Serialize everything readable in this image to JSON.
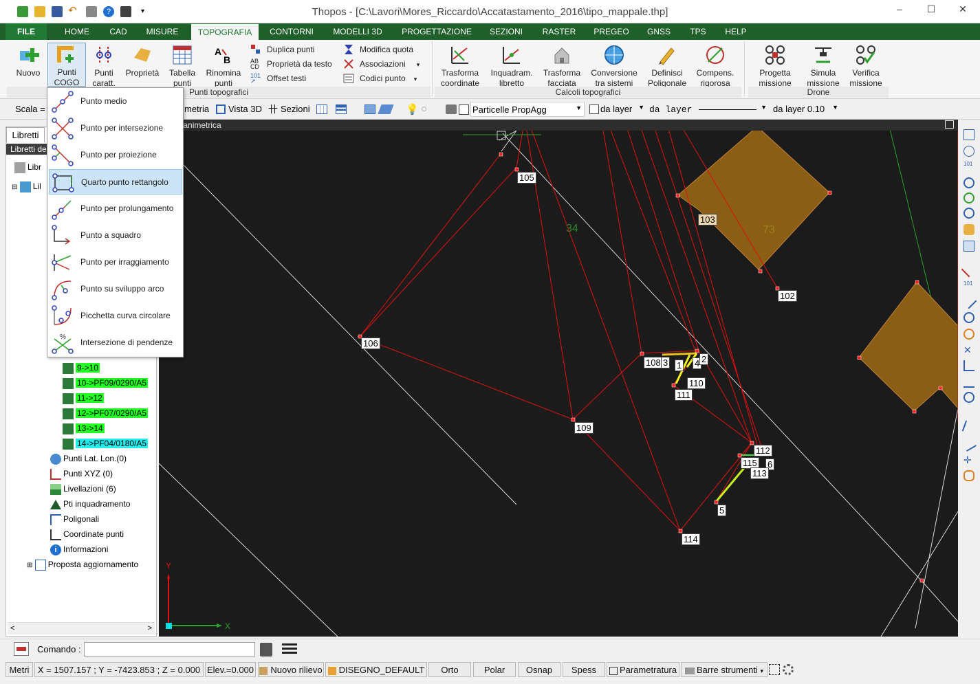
{
  "window": {
    "title": "Thopos - [C:\\Lavori\\Mores_Riccardo\\Accatastamento_2016\\tipo_mappale.thp]",
    "controls": [
      "–",
      "☐",
      "✕"
    ]
  },
  "ribbon_tabs": [
    "FILE",
    "HOME",
    "CAD",
    "MISURE",
    "TOPOGRAFIA",
    "CONTORNI",
    "MODELLI 3D",
    "PROGETTAZIONE",
    "SEZIONI",
    "RASTER",
    "PREGEO",
    "GNSS",
    "TPS",
    "HELP"
  ],
  "ribbon": {
    "nuovo": "Nuovo",
    "punti_cogo_1": "Punti",
    "punti_cogo_2": "COGO",
    "punti_caratt_1": "Punti",
    "punti_caratt_2": "caratt.",
    "proprieta": "Proprietà",
    "tabella_1": "Tabella",
    "tabella_2": "punti",
    "rinomina_1": "Rinomina",
    "rinomina_2": "punti",
    "duplica": "Duplica punti",
    "proprieta_testo": "Proprietà da testo",
    "offset": "Offset testi",
    "modifica_quota": "Modifica quota",
    "associazioni": "Associazioni",
    "codici": "Codici punto",
    "group_punti": "Punti topografici",
    "trasforma_1": "Trasforma",
    "trasforma_2": "coordinate",
    "inquadram_1": "Inquadram.",
    "inquadram_2": "libretto",
    "trasforma_f_1": "Trasforma",
    "trasforma_f_2": "facciata",
    "conversione_1": "Conversione",
    "conversione_2": "tra sistemi",
    "definisci_1": "Definisci",
    "definisci_2": "Poligonale",
    "compens_1": "Compens.",
    "compens_2": "rigorosa",
    "group_calcoli": "Calcoli topografici",
    "progetta_1": "Progetta",
    "progetta_2": "missione",
    "simula_1": "Simula",
    "simula_2": "missione",
    "verifica_1": "Verifica",
    "verifica_2": "missione",
    "group_drone": "Drone"
  },
  "toolbar2": {
    "scala": "Scala =",
    "planimetria": "metria",
    "vista3d": "Vista 3D",
    "sezioni": "Sezioni",
    "layer_combo": "Particelle PropAgg",
    "colore": "da layer",
    "linetype": "da layer",
    "spessore": "da layer 0.10"
  },
  "left_panel": {
    "tab": "Libretti",
    "header": "Libretti de",
    "root1": "Libr",
    "root2": "Lil",
    "items_green": [
      "9->10",
      "10->PF09/0290/A5",
      "11->12",
      "12->PF07/0290/A5",
      "13->14"
    ],
    "item_cyan": "14->PF04/0180/A5",
    "tree": [
      "Punti Lat. Lon.(0)",
      "Punti XYZ (0)",
      "Livellazioni (6)",
      "Pti inquadramento",
      "Poligonali",
      "Coordinate punti",
      "Informazioni"
    ],
    "proposta": "Proposta aggiornamento"
  },
  "cogo_menu": [
    "Punto medio",
    "Punto per intersezione",
    "Punto per proiezione",
    "Quarto punto rettangolo",
    "Punto per prolungamento",
    "Punto a squadro",
    "Punto per irraggiamento",
    "Punto su sviluppo arco",
    "Picchetta curva circolare",
    "Intersezione di pendenze"
  ],
  "cogo_selected_index": 3,
  "canvas": {
    "header": "planimetrica",
    "point_labels": [
      "105",
      "103",
      "102",
      "106",
      "108",
      "3",
      "1",
      "4",
      "2",
      "110",
      "111",
      "109",
      "112",
      "115",
      "6",
      "113",
      "5",
      "114"
    ],
    "faint_labels": [
      "34",
      "73"
    ],
    "axis_x": "X",
    "axis_y": "Y"
  },
  "command": {
    "label": "Comando :"
  },
  "status": {
    "units": "Metri",
    "coords": "X = 1507.157 ; Y = -7423.853 ; Z = 0.000",
    "elev": "Elev.=0.000",
    "rilievo": "Nuovo rilievo",
    "disegno": "DISEGNO_DEFAULT",
    "orto": "Orto",
    "polar": "Polar",
    "osnap": "Osnap",
    "spess": "Spess",
    "param": "Parametratura",
    "barre": "Barre strumenti"
  },
  "colors": {
    "ribbon_dark": "#1f5f2a",
    "file_tab": "#207a34",
    "canvas_bg": "#1b1b1b",
    "parcel_fill": "#8a5e14",
    "red_lines": "#e01010",
    "selection": "#cce4f7"
  }
}
